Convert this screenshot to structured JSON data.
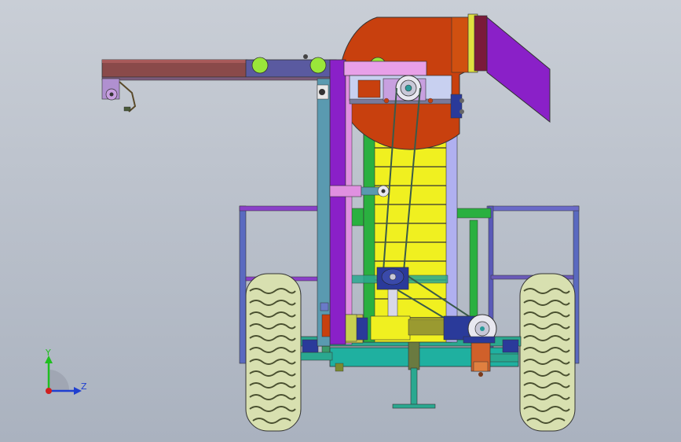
{
  "viewport": {
    "background_top": "#c9ced6",
    "background_bottom": "#aab2bf"
  },
  "triad": {
    "y_label": "Y",
    "z_label": "Z",
    "y_color": "#1fbf1f",
    "z_color": "#1f3fd0",
    "x_color": "#d01f1f"
  },
  "colors": {
    "arm": "#8a4a4a",
    "arm_band": "#5a5aa0",
    "blower": "#c8400e",
    "chute": "#8a20c8",
    "chute_frame": "#7a1a3a",
    "elevator_belt": "#f0f020",
    "mast_purple": "#8a20c8",
    "frame_green": "#2ab040",
    "frame_teal": "#2aa890",
    "tire": "#d8e0b0",
    "tire_dark": "#4a5030",
    "motor": "#d0602a",
    "bearing_blue": "#2a3a9a",
    "pulley": "#e8e8f0",
    "knob_green": "#9ae63a"
  }
}
